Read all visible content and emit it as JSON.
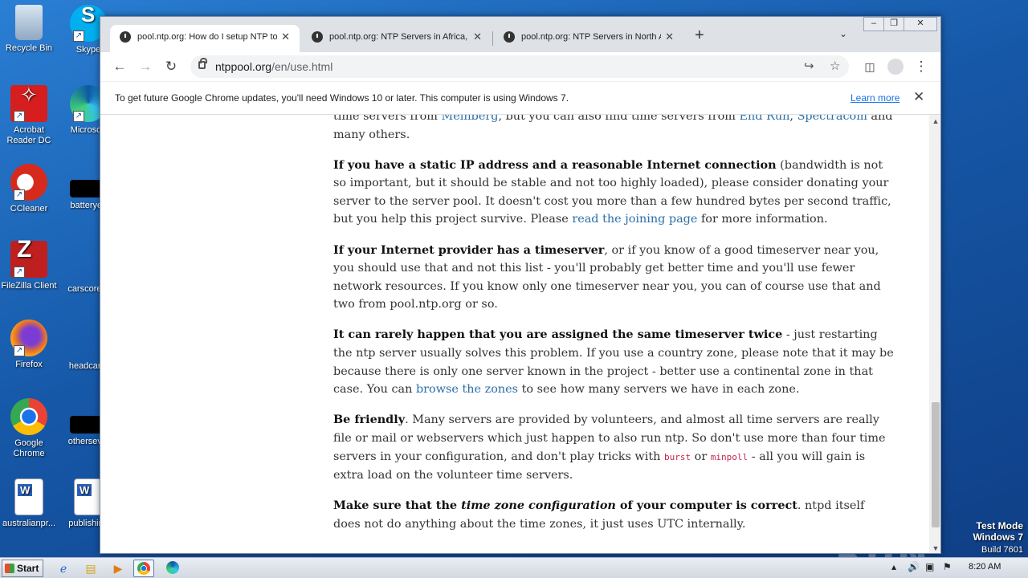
{
  "desktop": {
    "icons": [
      {
        "label": "Recycle Bin"
      },
      {
        "label": "Skype"
      },
      {
        "label": "Acrobat Reader DC"
      },
      {
        "label": "Microsoft"
      },
      {
        "label": "CCleaner"
      },
      {
        "label": "batteryey"
      },
      {
        "label": "FileZilla Client"
      },
      {
        "label": "carscore..."
      },
      {
        "label": "Firefox"
      },
      {
        "label": "headcar..."
      },
      {
        "label": "Google Chrome"
      },
      {
        "label": "othersev..."
      },
      {
        "label": "australianpr..."
      },
      {
        "label": "publishing"
      }
    ],
    "watermark": {
      "line1": "Test Mode",
      "line2": "Windows 7",
      "line3": "Build 7601"
    },
    "anyrun_text": "ANY RUN"
  },
  "browser": {
    "tabs": [
      {
        "title": "pool.ntp.org: How do I setup NTP to",
        "active": true
      },
      {
        "title": "pool.ntp.org: NTP Servers in Africa,",
        "active": false
      },
      {
        "title": "pool.ntp.org: NTP Servers in North A",
        "active": false
      }
    ],
    "new_tab_label": "+",
    "url_host": "ntppool.org",
    "url_path": "/en/use.html",
    "infobar": {
      "message": "To get future Google Chrome updates, you'll need Windows 10 or later. This computer is using Windows 7.",
      "learn_more": "Learn more"
    }
  },
  "article": {
    "p0": {
      "t1": "time servers from ",
      "link1": "Meinberg",
      "t2": ", but you can also find time servers from ",
      "link2": "End Run",
      "t3": ", ",
      "link3": "Spectracom",
      "t4": " and many others."
    },
    "p1": {
      "bold": "If you have a static IP address and a reasonable Internet connection",
      "t1": " (bandwidth is not so important, but it should be stable and not too highly loaded), please consider donating your server to the server pool. It doesn't cost you more than a few hundred bytes per second traffic, but you help this project survive. Please ",
      "link": "read the joining page",
      "t2": " for more information."
    },
    "p2": {
      "bold": "If your Internet provider has a timeserver",
      "t1": ", or if you know of a good timeserver near you, you should use that and not this list - you'll probably get better time and you'll use fewer network resources. If you know only one timeserver near you, you can of course use that and two from pool.ntp.org or so."
    },
    "p3": {
      "bold": "It can rarely happen that you are assigned the same timeserver twice",
      "t1": " - just restarting the ntp server usually solves this problem. If you use a country zone, please note that it may be because there is only one server known in the project - better use a continental zone in that case. You can ",
      "link": "browse the zones",
      "t2": " to see how many servers we have in each zone."
    },
    "p4": {
      "bold": "Be friendly",
      "t1": ". Many servers are provided by volunteers, and almost all time servers are really file or mail or webservers which just happen to also run ntp. So don't use more than four time servers in your configuration, and don't play tricks with ",
      "code1": "burst",
      "t2": " or ",
      "code2": "minpoll",
      "t3": " - all you will gain is extra load on the volunteer time servers."
    },
    "p5": {
      "bold1": "Make sure that the ",
      "bold_italic": "time zone configuration",
      "bold2": " of your computer is correct",
      "t1": ". ntpd itself does not do anything about the time zones, it just uses UTC internally."
    }
  },
  "taskbar": {
    "start_label": "Start",
    "clock": "8:20 AM"
  },
  "colors": {
    "link": "#2a6fa8",
    "code": "#c7254e",
    "desktop_bg": "#1658a8"
  }
}
